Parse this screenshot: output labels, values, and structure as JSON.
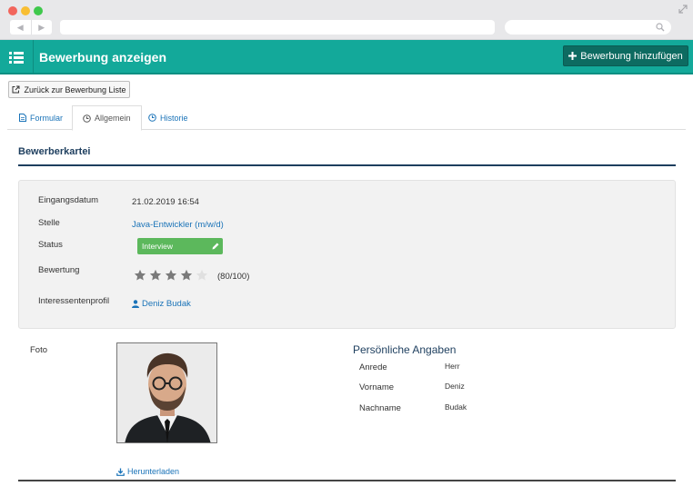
{
  "header": {
    "title": "Bewerbung anzeigen",
    "add_button": "Bewerbung hinzufügen"
  },
  "back_button": "Zurück zur Bewerbung Liste",
  "tabs": [
    {
      "label": "Formular",
      "icon": "document-icon"
    },
    {
      "label": "Allgemein",
      "icon": "clock-icon",
      "active": true
    },
    {
      "label": "Historie",
      "icon": "history-icon"
    }
  ],
  "section_title": "Bewerberkartei",
  "fields": {
    "eingangsdatum": {
      "label": "Eingangsdatum",
      "value": "21.02.2019 16:54"
    },
    "stelle": {
      "label": "Stelle",
      "value": "Java-Entwickler (m/w/d)"
    },
    "status": {
      "label": "Status",
      "value": "Interview"
    },
    "bewertung": {
      "label": "Bewertung",
      "value": "(80/100)",
      "stars_filled": 4,
      "stars_total": 5
    },
    "profil": {
      "label": "Interessentenprofil",
      "value": "Deniz Budak"
    }
  },
  "foto": {
    "label": "Foto",
    "download": "Herunterladen"
  },
  "personal": {
    "title": "Persönliche Angaben",
    "rows": [
      {
        "label": "Anrede",
        "value": "Herr"
      },
      {
        "label": "Vorname",
        "value": "Deniz"
      },
      {
        "label": "Nachname",
        "value": "Budak"
      }
    ]
  },
  "colors": {
    "header": "#13a99a",
    "add_button": "#0d6b61",
    "status_badge": "#5cb85c",
    "link": "#1a73b8",
    "section": "#1d3e5e"
  }
}
